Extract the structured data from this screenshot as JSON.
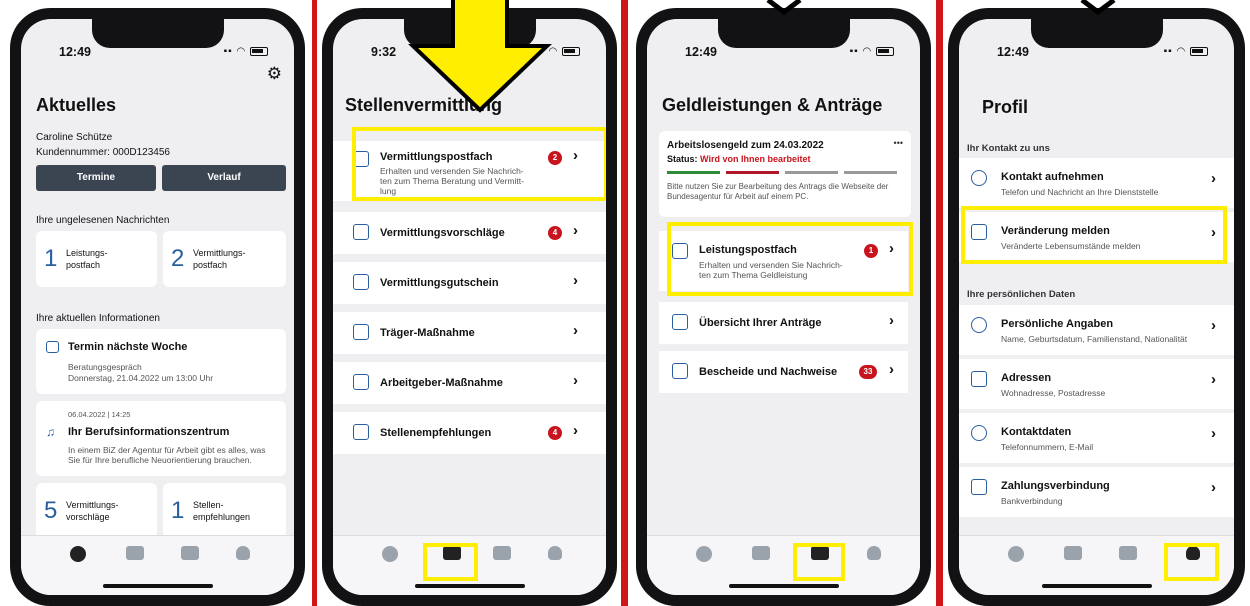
{
  "status_time": "12:49",
  "status_time_2": "9:32",
  "screen1": {
    "title": "Aktuelles",
    "user_name": "Caroline Schütze",
    "customer_number": "Kundennummer: 000D123456",
    "btn_termine": "Termine",
    "btn_verlauf": "Verlauf",
    "unread_heading": "Ihre ungelesenen Nachrichten",
    "unread_1_count": "1",
    "unread_1_label": "Leistungs-\npostfach",
    "unread_2_count": "2",
    "unread_2_label": "Vermittlungs-\npostfach",
    "info_heading": "Ihre aktuellen Informationen",
    "termin_title": "Termin nächste Woche",
    "termin_sub1": "Beratungsgespräch",
    "termin_sub2": "Donnerstag, 21.04.2022 um 13:00 Uhr",
    "biz_date": "06.04.2022 | 14:25",
    "biz_title": "Ihr Berufsinformationszentrum",
    "biz_text": "In einem BiZ der Agentur für Arbeit gibt es alles, was Sie für Ihre berufliche Neuorientierung brauchen.",
    "tile_1_count": "5",
    "tile_1_label": "Vermittlungs-\nvorschläge",
    "tile_2_count": "1",
    "tile_2_label": "Stellen-\nempfehlungen"
  },
  "screen2": {
    "title": "Stellenvermittlung",
    "items": [
      {
        "label": "Vermittlungspostfach",
        "sub": "Erhalten und versenden Sie Nachrich-\nten zum Thema Beratung und Vermitt-\nlung",
        "badge": "2"
      },
      {
        "label": "Vermittlungsvorschläge",
        "sub": "",
        "badge": "4"
      },
      {
        "label": "Vermittlungsgutschein",
        "sub": "",
        "badge": ""
      },
      {
        "label": "Träger-Maßnahme",
        "sub": "",
        "badge": ""
      },
      {
        "label": "Arbeitgeber-Maßnahme",
        "sub": "",
        "badge": ""
      },
      {
        "label": "Stellenempfehlungen",
        "sub": "",
        "badge": "4"
      }
    ]
  },
  "screen3": {
    "title": "Geldleistungen & Anträge",
    "alg_title": "Arbeitslosengeld zum 24.03.2022",
    "alg_status_label": "Status:",
    "alg_status_value": "Wird von Ihnen bearbeitet",
    "alg_hint": "Bitte nutzen Sie zur Bearbeitung des Antrags die Webseite der Bundesagentur für Arbeit auf einem PC.",
    "more": "•••",
    "items": [
      {
        "label": "Leistungspostfach",
        "sub": "Erhalten und versenden Sie Nachrich-\nten zum Thema Geldleistung",
        "badge": "1"
      },
      {
        "label": "Übersicht Ihrer Anträge",
        "sub": "",
        "badge": ""
      },
      {
        "label": "Bescheide und Nachweise",
        "sub": "",
        "badge": "33"
      }
    ]
  },
  "screen4": {
    "title": "Profil",
    "section_1": "Ihr Kontakt zu uns",
    "section_2": "Ihre persönlichen Daten",
    "items": [
      {
        "label": "Kontakt aufnehmen",
        "sub": "Telefon und Nachricht an Ihre Dienststelle"
      },
      {
        "label": "Veränderung melden",
        "sub": "Veränderte Lebensumstände melden"
      },
      {
        "label": "Persönliche Angaben",
        "sub": "Name, Geburtsdatum, Familienstand, Nationalität"
      },
      {
        "label": "Adressen",
        "sub": "Wohnadresse, Postadresse"
      },
      {
        "label": "Kontaktdaten",
        "sub": "Telefonnummern, E-Mail"
      },
      {
        "label": "Zahlungsverbindung",
        "sub": "Bankverbindung"
      }
    ]
  },
  "colors": {
    "accent_blue": "#2a5f9e",
    "badge_red": "#c8141e",
    "highlight": "#ffee00",
    "backdrop_red": "#d01616"
  }
}
